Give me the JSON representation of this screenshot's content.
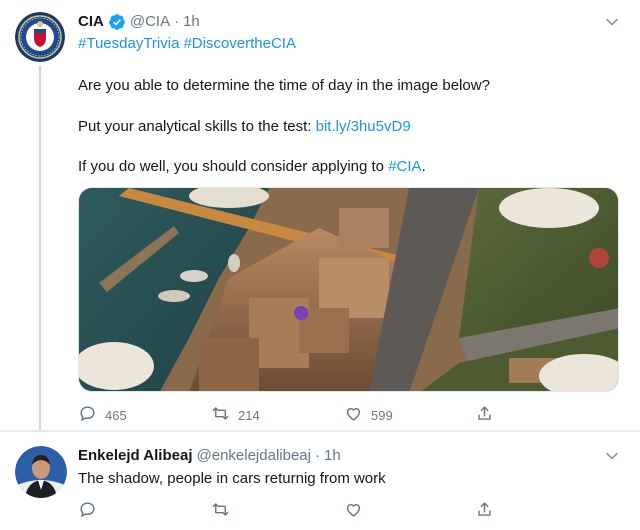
{
  "tweet": {
    "author": {
      "display_name": "CIA",
      "handle": "@CIA",
      "separator": "·",
      "time": "1h",
      "verified": true
    },
    "hashtags": [
      "#TuesdayTrivia",
      "#DiscovertheCIA"
    ],
    "text": {
      "line1": "Are you able to determine the time of day in the image below?",
      "line2_prefix": "Put your analytical skills to the test: ",
      "line2_link": "bit.ly/3hu5vD9",
      "line3_prefix": "If you do well, you should consider applying to ",
      "line3_link": "#CIA",
      "line3_suffix": "."
    },
    "actions": {
      "replies": "465",
      "retweets": "214",
      "likes": "599"
    }
  },
  "reply": {
    "author": {
      "display_name": "Enkelejd Alibeaj",
      "handle": "@enkelejdalibeaj",
      "separator": "·",
      "time": "1h"
    },
    "text": "The shadow, people in cars returnig from work"
  },
  "colors": {
    "link": "#1b95e0",
    "secondary_text": "#657786",
    "verified": "#1da1f2"
  },
  "icons": [
    "cia-seal-avatar",
    "verified-badge-icon",
    "caret-down-icon",
    "reply-icon",
    "retweet-icon",
    "like-icon",
    "share-icon"
  ]
}
